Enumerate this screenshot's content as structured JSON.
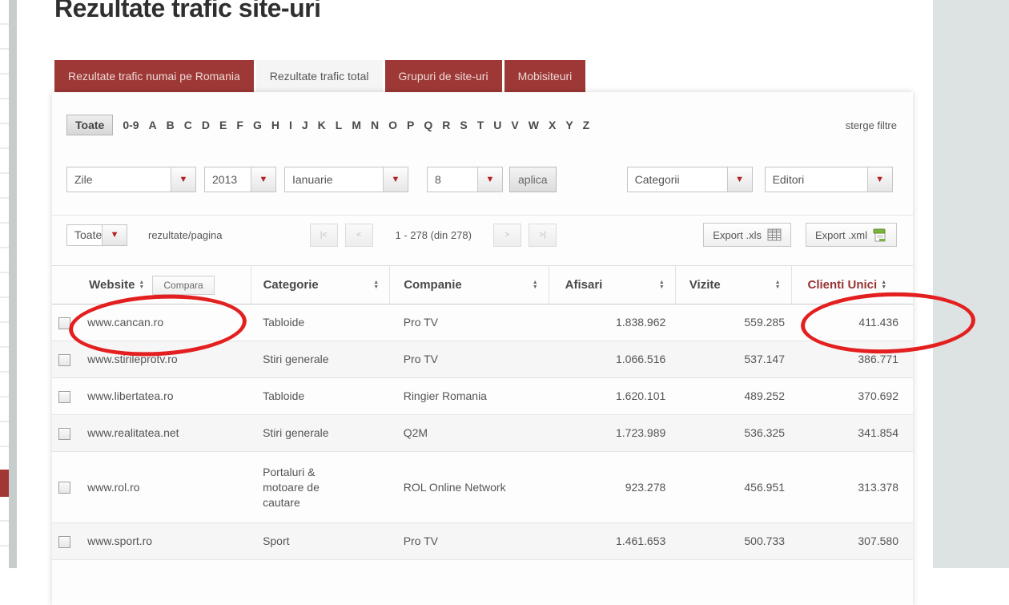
{
  "page": {
    "title": "Rezultate trafic site-uri"
  },
  "tabs": [
    {
      "label": "Rezultate trafic numai pe Romania",
      "active": false
    },
    {
      "label": "Rezultate trafic total",
      "active": true
    },
    {
      "label": "Grupuri de site-uri",
      "active": false
    },
    {
      "label": "Mobisiteuri",
      "active": false
    }
  ],
  "alphabet": {
    "all_label": "Toate",
    "letters": [
      "0-9",
      "A",
      "B",
      "C",
      "D",
      "E",
      "F",
      "G",
      "H",
      "I",
      "J",
      "K",
      "L",
      "M",
      "N",
      "O",
      "P",
      "Q",
      "R",
      "S",
      "T",
      "U",
      "V",
      "W",
      "X",
      "Y",
      "Z"
    ],
    "clear_label": "sterge filtre"
  },
  "filters": {
    "period": "Zile",
    "year": "2013",
    "month": "Ianuarie",
    "day": "8",
    "apply_label": "aplica",
    "categories": "Categorii",
    "publishers": "Editori"
  },
  "toolbar": {
    "per_page": "Toate",
    "per_page_label": "rezultate/pagina",
    "range_text": "1 - 278 (din 278)",
    "pager": {
      "first": "|<",
      "prev": "<",
      "next": ">",
      "last": ">|"
    },
    "export_xls": "Export .xls",
    "export_xml": "Export .xml"
  },
  "table": {
    "headers": {
      "website": "Website",
      "compara": "Compara",
      "categorie": "Categorie",
      "companie": "Companie",
      "afisari": "Afisari",
      "vizite": "Vizite",
      "clienti": "Clienti Unici"
    },
    "rows": [
      {
        "website": "www.cancan.ro",
        "categorie": "Tabloide",
        "companie": "Pro TV",
        "afisari": "1.838.962",
        "vizite": "559.285",
        "clienti": "411.436"
      },
      {
        "website": "www.stirileprotv.ro",
        "categorie": "Stiri generale",
        "companie": "Pro TV",
        "afisari": "1.066.516",
        "vizite": "537.147",
        "clienti": "386.771"
      },
      {
        "website": "www.libertatea.ro",
        "categorie": "Tabloide",
        "companie": "Ringier Romania",
        "afisari": "1.620.101",
        "vizite": "489.252",
        "clienti": "370.692"
      },
      {
        "website": "www.realitatea.net",
        "categorie": "Stiri generale",
        "companie": "Q2M",
        "afisari": "1.723.989",
        "vizite": "536.325",
        "clienti": "341.854"
      },
      {
        "website": "www.rol.ro",
        "categorie": "Portaluri & motoare de cautare",
        "companie": "ROL Online Network",
        "afisari": "923.278",
        "vizite": "456.951",
        "clienti": "313.378"
      },
      {
        "website": "www.sport.ro",
        "categorie": "Sport",
        "companie": "Pro TV",
        "afisari": "1.461.653",
        "vizite": "500.733",
        "clienti": "307.580"
      }
    ]
  },
  "icons": {
    "dropdown_arrow": "▼",
    "sort_up": "▲",
    "sort_down": "▼"
  },
  "colors": {
    "tab_red": "#9d3836",
    "sorted_column_red": "#993333",
    "annotation_red": "#e41f1f"
  }
}
